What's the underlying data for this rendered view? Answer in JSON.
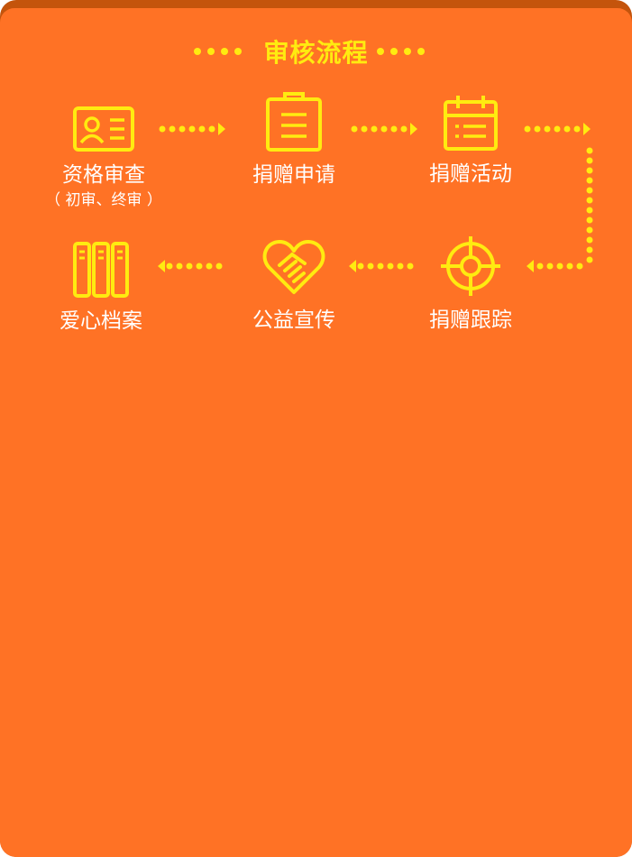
{
  "title": "审核流程",
  "steps": [
    {
      "label": "资格审查",
      "sub": "（ 初审、终审 ）",
      "icon": "id-card-icon"
    },
    {
      "label": "捐赠申请",
      "icon": "clipboard-icon"
    },
    {
      "label": "捐赠活动",
      "icon": "calendar-icon"
    },
    {
      "label": "捐赠跟踪",
      "icon": "target-icon"
    },
    {
      "label": "公益宣传",
      "icon": "heart-handshake-icon"
    },
    {
      "label": "爱心档案",
      "icon": "binders-icon"
    }
  ],
  "colors": {
    "background": "#ff7225",
    "border": "#c4540c",
    "accent": "#ffeb10",
    "text": "#ffffff"
  }
}
